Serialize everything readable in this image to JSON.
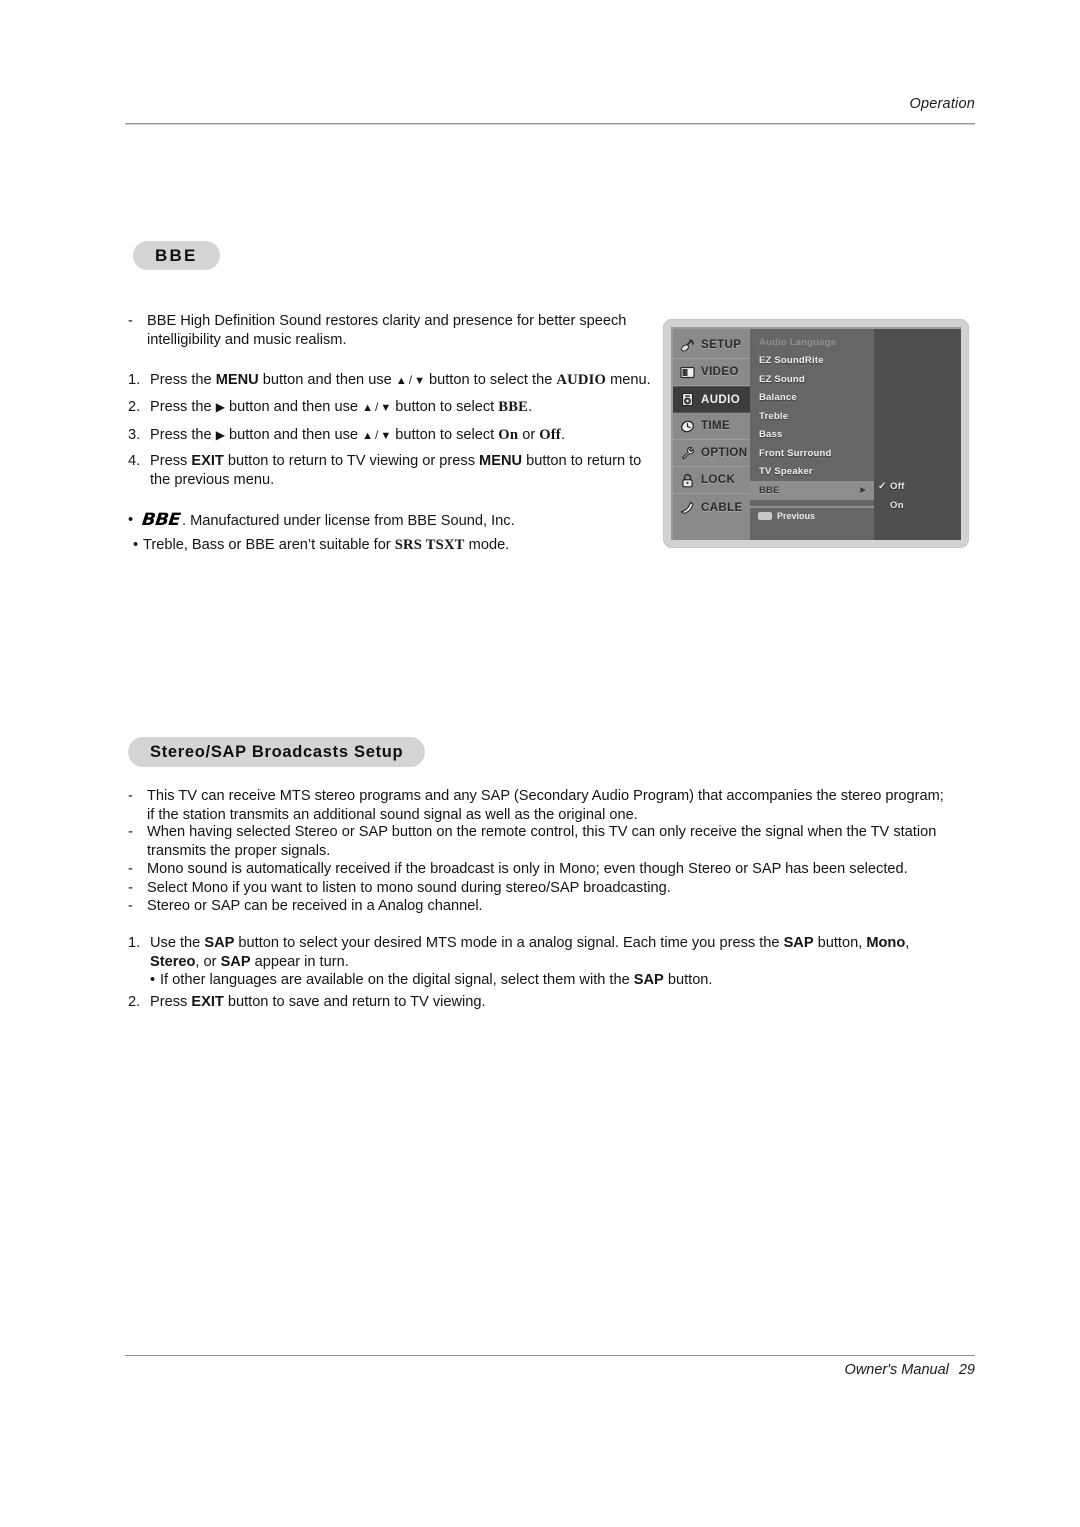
{
  "header": {
    "running_head": "Operation"
  },
  "footer": {
    "manual_label": "Owner's Manual",
    "page_number": "29"
  },
  "sections": {
    "bbe": {
      "pill_label": "BBE",
      "intro": {
        "marker": "-",
        "line1": "BBE High Definition Sound restores clarity and presence for better speech",
        "line2": "intelligibility and music realism."
      },
      "steps": [
        {
          "marker": "1.",
          "t1": "Press the ",
          "k1": "MENU",
          "t2": " button and then use ",
          "t3": " button to select the ",
          "k2": "AUDIO",
          "t4": " menu."
        },
        {
          "marker": "2.",
          "t1": "Press the ",
          "t2": " button and then use ",
          "t3": " button to select ",
          "k2": "BBE",
          "t4": "."
        },
        {
          "marker": "3.",
          "t1": "Press the ",
          "t2": " button and then use ",
          "t3": " button to select ",
          "k2": "On",
          "t4": " or ",
          "k3": "Off",
          "t5": "."
        },
        {
          "marker": "4.",
          "t1": "Press ",
          "k1": "EXIT",
          "t2": " button to return to TV viewing or press ",
          "k2": "MENU",
          "t3": " button to return to",
          "line2": "the previous menu."
        }
      ],
      "notes": [
        {
          "marker": "•",
          "logo": "BBE",
          "text": ". Manufactured under license from BBE Sound, Inc."
        },
        {
          "marker": "•",
          "t1": "Treble, Bass or BBE aren’t suitable for ",
          "k1": "SRS TSXT",
          "t2": " mode."
        }
      ]
    },
    "stereo_sap": {
      "pill_label": "Stereo/SAP Broadcasts Setup",
      "dashes": [
        {
          "marker": "-",
          "line1": "This TV can receive MTS stereo programs and any SAP (Secondary Audio Program) that accompanies the stereo program;",
          "line2": "if the station transmits an additional sound signal as well as the original one."
        },
        {
          "marker": "-",
          "line1": "When having selected Stereo or SAP button on the remote control, this TV can only receive the signal when the TV station",
          "line2": "transmits the proper signals."
        },
        {
          "marker": "-",
          "line1": "Mono sound is automatically received if the broadcast is only in Mono; even though Stereo or SAP has been selected."
        },
        {
          "marker": "-",
          "line1": "Select Mono if you want to listen to mono sound during stereo/SAP broadcasting."
        },
        {
          "marker": "-",
          "line1": "Stereo or SAP can be received in a Analog channel."
        }
      ],
      "steps": [
        {
          "marker": "1.",
          "t1": "Use the ",
          "k1": "SAP",
          "t2": " button to select your desired MTS mode in a analog signal. Each time you press the ",
          "k2": "SAP",
          "t3": " button, ",
          "k3": "Mono",
          "t4": ",",
          "k4": "Stereo",
          "t5": ", or ",
          "k5": "SAP",
          "t6": " appear in turn.",
          "sub": {
            "marker": "•",
            "t1": "If other languages are available on the digital signal, select them with the ",
            "k1": "SAP",
            "t2": " button."
          }
        },
        {
          "marker": "2.",
          "t1": "Press ",
          "k1": "EXIT",
          "t2": " button to save and return to TV viewing."
        }
      ]
    }
  },
  "osd": {
    "rail": [
      {
        "label": "SETUP",
        "icon": "satellite-dish-icon",
        "active": false
      },
      {
        "label": "VIDEO",
        "icon": "monitor-icon",
        "active": false
      },
      {
        "label": "AUDIO",
        "icon": "speaker-icon",
        "active": true
      },
      {
        "label": "TIME",
        "icon": "clock-icon",
        "active": false
      },
      {
        "label": "OPTION",
        "icon": "wrench-icon",
        "active": false
      },
      {
        "label": "LOCK",
        "icon": "padlock-icon",
        "active": false
      },
      {
        "label": "CABLE",
        "icon": "cable-plug-icon",
        "active": false
      }
    ],
    "menu_items": [
      {
        "label": "Audio Language",
        "state": "dim"
      },
      {
        "label": "EZ SoundRite",
        "state": "normal"
      },
      {
        "label": "EZ Sound",
        "state": "normal"
      },
      {
        "label": "Balance",
        "state": "normal"
      },
      {
        "label": "Treble",
        "state": "normal"
      },
      {
        "label": "Bass",
        "state": "normal"
      },
      {
        "label": "Front Surround",
        "state": "normal"
      },
      {
        "label": "TV Speaker",
        "state": "normal"
      },
      {
        "label": "BBE",
        "state": "selected"
      }
    ],
    "submenu_arrow": "▶",
    "values": [
      {
        "label": "Off",
        "checked": true,
        "check_glyph": "✓"
      },
      {
        "label": "On",
        "checked": false,
        "check_glyph": ""
      }
    ],
    "previous_label": "Previous",
    "colors": {
      "bezel": "#d2d2d2",
      "rail": "#8a8a8a",
      "list": "#666666",
      "panel": "#4f4f4f",
      "active_item": "#3d3d3d",
      "selected_row": "#8e8e8e"
    }
  }
}
